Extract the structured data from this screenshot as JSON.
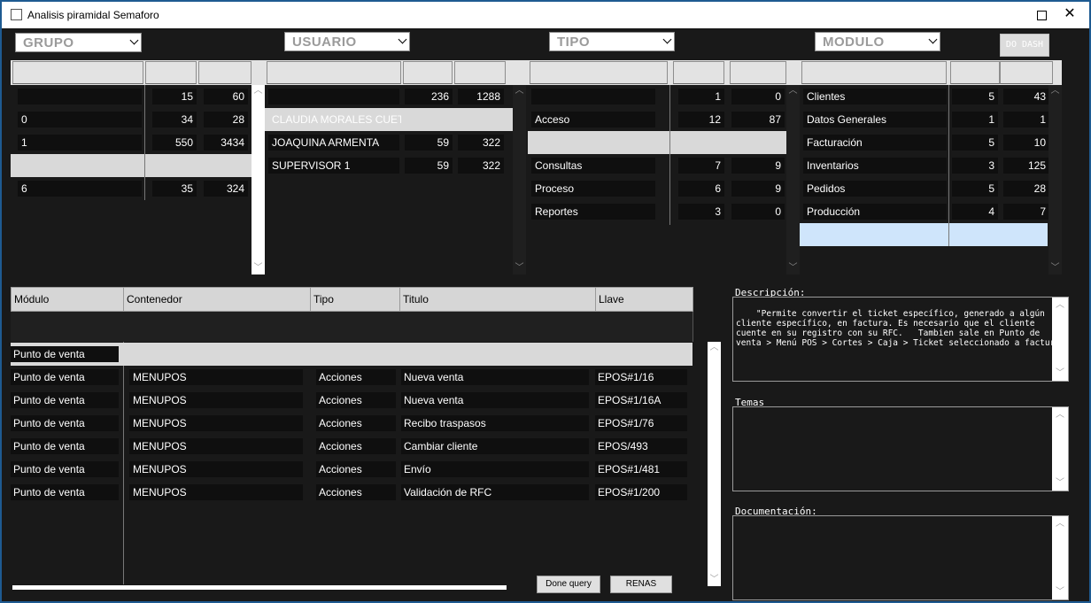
{
  "window": {
    "title": "Analisis piramidal  Semaforo"
  },
  "filters": {
    "grupo": "GRUPO",
    "usuario": "USUARIO",
    "tipo": "TIPO",
    "modulo": "MODULO",
    "dash_button": "DO DASH"
  },
  "grupo_table": {
    "rows": [
      {
        "name": "",
        "a": "15",
        "b": "60"
      },
      {
        "name": "0",
        "a": "34",
        "b": "28"
      },
      {
        "name": "1",
        "a": "550",
        "b": "3434"
      },
      {
        "name": "",
        "a": "",
        "b": ""
      },
      {
        "name": "6",
        "a": "35",
        "b": "324"
      }
    ]
  },
  "usuario_table": {
    "rows": [
      {
        "name": "",
        "a": "236",
        "b": "1288"
      },
      {
        "name": "CLAUDIA MORALES CUET",
        "a": "",
        "b": ""
      },
      {
        "name": "JOAQUINA ARMENTA",
        "a": "59",
        "b": "322"
      },
      {
        "name": "SUPERVISOR 1",
        "a": "59",
        "b": "322"
      }
    ]
  },
  "tipo_table": {
    "rows": [
      {
        "name": "",
        "a": "1",
        "b": "0"
      },
      {
        "name": "Acceso",
        "a": "12",
        "b": "87"
      },
      {
        "name": "",
        "a": "",
        "b": ""
      },
      {
        "name": "Consultas",
        "a": "7",
        "b": "9"
      },
      {
        "name": "Proceso",
        "a": "6",
        "b": "9"
      },
      {
        "name": "Reportes",
        "a": "3",
        "b": "0"
      }
    ]
  },
  "modulo_table": {
    "rows": [
      {
        "name": "Clientes",
        "a": "5",
        "b": "43"
      },
      {
        "name": "Datos Generales",
        "a": "1",
        "b": "1"
      },
      {
        "name": "Facturación",
        "a": "5",
        "b": "10"
      },
      {
        "name": "Inventarios",
        "a": "3",
        "b": "125"
      },
      {
        "name": "Pedidos",
        "a": "5",
        "b": "28"
      },
      {
        "name": "Producción",
        "a": "4",
        "b": "7"
      },
      {
        "name": "",
        "a": "",
        "b": ""
      }
    ]
  },
  "main_table": {
    "headers": [
      "Módulo",
      "Contenedor",
      "Tipo",
      "Titulo",
      "Llave"
    ],
    "rows": [
      {
        "modulo": "Punto de venta",
        "contenedor": "",
        "tipo": "",
        "titulo": "",
        "llave": ""
      },
      {
        "modulo": "Punto de venta",
        "contenedor": "MENUPOS",
        "tipo": "Acciones",
        "titulo": "Nueva venta",
        "llave": "EPOS#1/16"
      },
      {
        "modulo": "Punto de venta",
        "contenedor": "MENUPOS",
        "tipo": "Acciones",
        "titulo": "Nueva venta",
        "llave": "EPOS#1/16A"
      },
      {
        "modulo": "Punto de venta",
        "contenedor": "MENUPOS",
        "tipo": "Acciones",
        "titulo": "Recibo traspasos",
        "llave": "EPOS#1/76"
      },
      {
        "modulo": "Punto de venta",
        "contenedor": "MENUPOS",
        "tipo": "Acciones",
        "titulo": "Cambiar cliente",
        "llave": "EPOS/493"
      },
      {
        "modulo": "Punto de venta",
        "contenedor": "MENUPOS",
        "tipo": "Acciones",
        "titulo": "Envío",
        "llave": "EPOS#1/481"
      },
      {
        "modulo": "Punto de venta",
        "contenedor": "MENUPOS",
        "tipo": "Acciones",
        "titulo": "Validación de RFC",
        "llave": "EPOS#1/200"
      }
    ]
  },
  "side": {
    "descripcion_label": "Descripción:",
    "descripcion_text": "\"Permite convertir el ticket específico, generado a algún cliente específico, en factura. Es necesario que el cliente cuente en su registro con su RFC.   Tambien sale en Punto de venta > Menú POS > Cortes > Caja > Ticket seleccionado a factura\"",
    "temas_label": "Temas",
    "documentacion_label": "Documentación:"
  },
  "bottom_buttons": {
    "left": "Done query",
    "right": "RENAS"
  }
}
